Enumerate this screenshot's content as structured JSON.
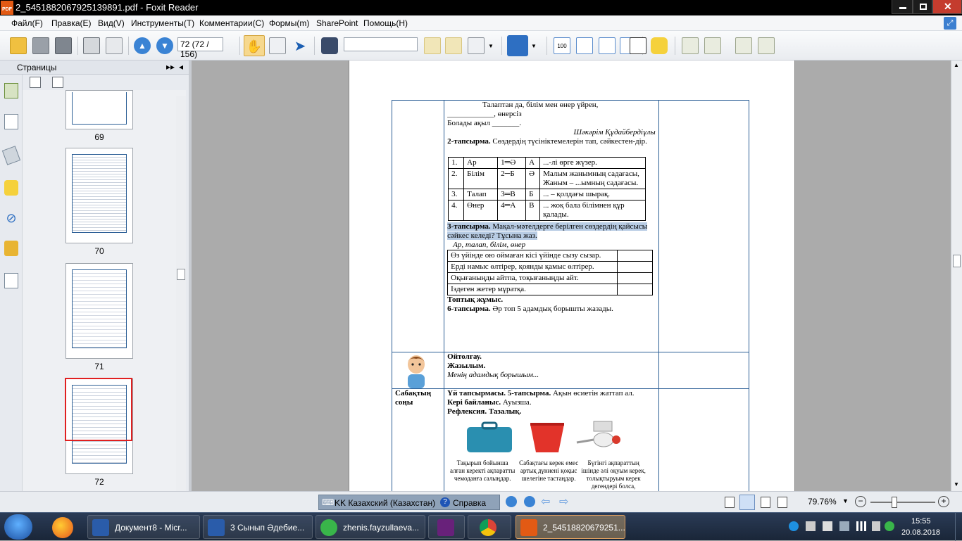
{
  "window": {
    "title": "2_5451882067925139891.pdf - Foxit Reader",
    "app_icon_text": "PDF"
  },
  "menu": [
    "Файл(F)",
    "Правка(E)",
    "Вид(V)",
    "Инструменты(T)",
    "Комментарии(C)",
    "Формы(m)",
    "SharePoint",
    "Помощь(H)"
  ],
  "toolbar": {
    "page_indicator": "72 (72 / 156)",
    "find_value": ""
  },
  "sidebar": {
    "title": "Страницы",
    "thumbs": [
      {
        "label": "69"
      },
      {
        "label": "70"
      },
      {
        "label": "71"
      },
      {
        "label": "72"
      }
    ]
  },
  "document": {
    "poem": {
      "l1": "Талаптан да, білім мен өнер үйрен,",
      "l2": "____________, өнерсіз",
      "l3": "Болады ақыл _______.",
      "author": "Шәкәрім Құдайбердіұлы"
    },
    "task2": {
      "head": "2-тапсырма.",
      "text": "Сөздердің түсініктемелерін тап, сәйкестен-дір.",
      "rows": [
        {
          "n": "1.",
          "w": "Ар",
          "k": "1═Ә",
          "l": "А",
          "d": "...-лі өрге жүзер."
        },
        {
          "n": "2.",
          "w": "Білім",
          "k": "2─Б",
          "l": "Ә",
          "d": "Малым жанымның садағасы,",
          "d2": "Жаным – ...ымның садағасы."
        },
        {
          "n": "3.",
          "w": "Талап",
          "k": "3═В",
          "l": "Б",
          "d": "... – қолдағы шырақ."
        },
        {
          "n": "4.",
          "w": "Өнер",
          "k": "4═А",
          "l": "В",
          "d": "... жоқ бала білімнен құр қалады."
        }
      ]
    },
    "task3": {
      "head": "3-тапсырма.",
      "text": "Мақал-мәтелдерге берілген сөздердің қайсысы сәйкес келеді? Тұсына жаз.",
      "words": "Ар, талап, білім, өнер",
      "proverbs": [
        "Өз үйінде ою оймаған кісі үйінде сызу сызар.",
        "Ерді намыс өлтірер, қоянды қамыс өлтірер.",
        "Оқығаныңды айтпа, тоқығаныңды айт.",
        "Іздеген жетер мұратқа."
      ]
    },
    "group": {
      "head": "Топтық жұмыс.",
      "task6_head": "6-тапсырма.",
      "task6": "Әр топ 5 адамдық борышты жазады."
    },
    "reading": {
      "l1": "Ойтолғау.",
      "l2": "Жазылым.",
      "l3": "Менің адамдық борышым..."
    },
    "end": {
      "label": "Сабақтың соңы",
      "hw_head": "Үй тапсырмасы. 5-тапсырма.",
      "hw": "Ақын өсиетін жаттап ал.",
      "fb_head": "Кері байланыс.",
      "fb": "Ауызша.",
      "refl": "Рефлексия. Тазалық.",
      "captions": [
        "Тақырып бойынша алған керекті ақпаратты чемоданға салыңдар.",
        "Сабақтағы керек емес артық дүниені қоқыс шелегіне тастаңдар.",
        "Бүгінгі ақпараттың ішінде әлі оқуым керек, толықтыруым керек дегендері болса, еттартқышқа"
      ]
    }
  },
  "statusbar": {
    "language": "KK Казахский (Казахстан)",
    "help": "Справка",
    "zoom": "79.76%"
  },
  "taskbar": {
    "items": [
      "Документ8 - Micr...",
      "3 Сынып Әдебие...",
      "zhenis.fayzullaeva...",
      "",
      "",
      "2_54518820679251..."
    ],
    "time": "15:55",
    "date": "20.08.2018"
  },
  "colors": {
    "accent": "#2b5e95",
    "highlight": "#b8cce4",
    "thumb_selected": "#e02020"
  }
}
